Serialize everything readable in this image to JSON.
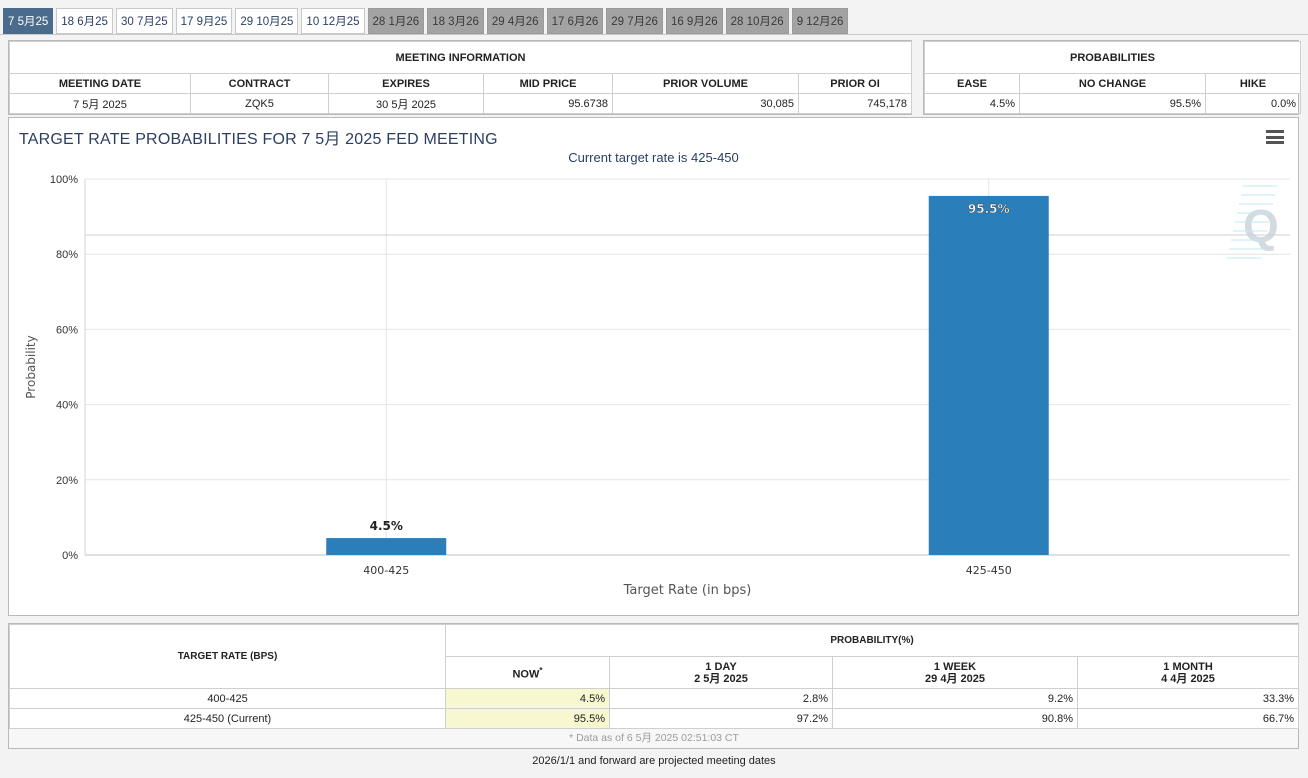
{
  "tabs": [
    {
      "label": "7 5月25",
      "state": "active"
    },
    {
      "label": "18 6月25",
      "state": "normal"
    },
    {
      "label": "30 7月25",
      "state": "normal"
    },
    {
      "label": "17 9月25",
      "state": "normal"
    },
    {
      "label": "29 10月25",
      "state": "normal"
    },
    {
      "label": "10 12月25",
      "state": "normal"
    },
    {
      "label": "28 1月26",
      "state": "future"
    },
    {
      "label": "18 3月26",
      "state": "future"
    },
    {
      "label": "29 4月26",
      "state": "future"
    },
    {
      "label": "17 6月26",
      "state": "future"
    },
    {
      "label": "29 7月26",
      "state": "future"
    },
    {
      "label": "16 9月26",
      "state": "future"
    },
    {
      "label": "28 10月26",
      "state": "future"
    },
    {
      "label": "9 12月26",
      "state": "future"
    }
  ],
  "meeting_info": {
    "title": "MEETING INFORMATION",
    "headers": [
      "MEETING DATE",
      "CONTRACT",
      "EXPIRES",
      "MID PRICE",
      "PRIOR VOLUME",
      "PRIOR OI"
    ],
    "values": [
      "7 5月 2025",
      "ZQK5",
      "30 5月 2025",
      "95.6738",
      "30,085",
      "745,178"
    ]
  },
  "probabilities": {
    "title": "PROBABILITIES",
    "headers": [
      "EASE",
      "NO CHANGE",
      "HIKE"
    ],
    "values": [
      "4.5%",
      "95.5%",
      "0.0%"
    ]
  },
  "chart": {
    "title": "TARGET RATE PROBABILITIES FOR 7 5月 2025 FED MEETING",
    "subtitle": "Current target rate is 425-450",
    "watermark": "Q"
  },
  "chart_data": {
    "type": "bar",
    "categories": [
      "400-425",
      "425-450"
    ],
    "values": [
      4.5,
      95.5
    ],
    "data_labels": [
      "4.5%",
      "95.5%"
    ],
    "xlabel": "Target Rate (in bps)",
    "ylabel": "Probability",
    "ylim": [
      0,
      100
    ],
    "y_ticks": [
      0,
      20,
      40,
      60,
      80,
      100
    ],
    "y_tick_labels": [
      "0%",
      "20%",
      "40%",
      "60%",
      "80%",
      "100%"
    ],
    "grid": true,
    "bar_color": "#2a7fba"
  },
  "prob_table": {
    "col_target": "TARGET RATE (BPS)",
    "group_header": "PROBABILITY(%)",
    "now_label": "NOW",
    "now_marker": "*",
    "day_label": "1 DAY",
    "day_date": "2 5月 2025",
    "week_label": "1 WEEK",
    "week_date": "29 4月 2025",
    "month_label": "1 MONTH",
    "month_date": "4 4月 2025",
    "rows": [
      {
        "rate": "400-425",
        "now": "4.5%",
        "day": "2.8%",
        "week": "9.2%",
        "month": "33.3%"
      },
      {
        "rate": "425-450 (Current)",
        "now": "95.5%",
        "day": "97.2%",
        "week": "90.8%",
        "month": "66.7%"
      }
    ],
    "footnote": "* Data as of 6 5月 2025 02:51:03 CT"
  },
  "projected_note": "2026/1/1 and forward are projected meeting dates"
}
